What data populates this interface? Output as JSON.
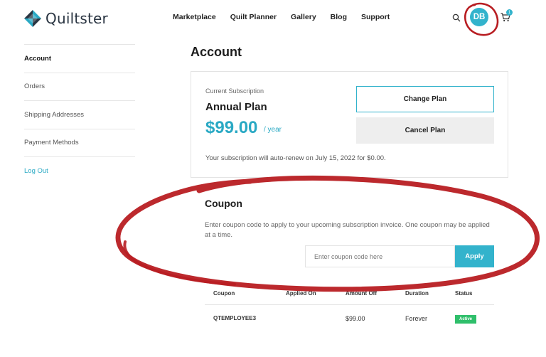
{
  "brand": {
    "name": "Quiltster"
  },
  "nav": [
    "Marketplace",
    "Quilt Planner",
    "Gallery",
    "Blog",
    "Support"
  ],
  "header": {
    "avatar_initials": "DB",
    "cart_count": "1"
  },
  "sidebar": {
    "items": [
      {
        "label": "Account"
      },
      {
        "label": "Orders"
      },
      {
        "label": "Shipping Addresses"
      },
      {
        "label": "Payment Methods"
      },
      {
        "label": "Log Out"
      }
    ]
  },
  "account": {
    "title": "Account",
    "subscription_label": "Current Subscription",
    "plan_name": "Annual Plan",
    "price": "$99.00",
    "period": "/ year",
    "change_plan": "Change Plan",
    "cancel_plan": "Cancel Plan",
    "renew_text": "Your subscription will auto-renew on July 15, 2022 for $0.00."
  },
  "coupon": {
    "title": "Coupon",
    "description": "Enter coupon code to apply to your upcoming subscription invoice. One coupon may be applied at a time.",
    "placeholder": "Enter coupon code here",
    "apply_label": "Apply",
    "table": {
      "headers": [
        "Coupon",
        "Applied On",
        "Amount Off",
        "Duration",
        "Status"
      ],
      "rows": [
        {
          "coupon": "QTEMPLOYEE3",
          "applied_on": "",
          "amount_off": "$99.00",
          "duration": "Forever",
          "status": "Active"
        }
      ]
    }
  },
  "colors": {
    "accent": "#33b3cc",
    "annotation": "#b81d22",
    "active_badge": "#2fbf6b"
  }
}
